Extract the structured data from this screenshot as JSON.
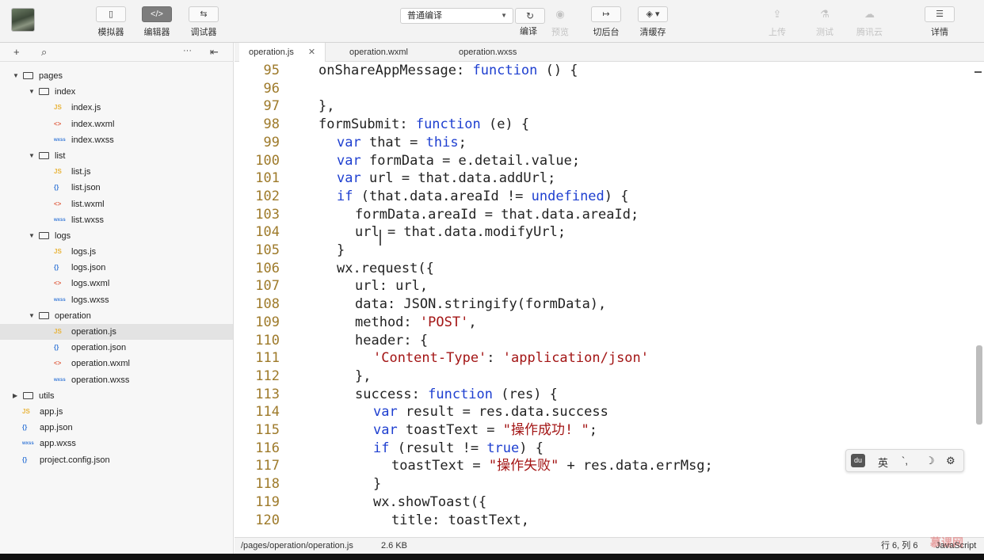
{
  "toolbar": {
    "simulator_label": "模拟器",
    "editor_label": "编辑器",
    "debugger_label": "调试器",
    "compile_mode": "普通编译",
    "compile_label": "编译",
    "preview_label": "预览",
    "background_label": "切后台",
    "clear_cache_label": "清缓存",
    "upload_label": "上传",
    "test_label": "测试",
    "tencent_cloud_label": "腾讯云",
    "details_label": "详情"
  },
  "tree": [
    {
      "kind": "folder",
      "name": "pages",
      "depth": 0,
      "open": true
    },
    {
      "kind": "folder",
      "name": "index",
      "depth": 1,
      "open": true
    },
    {
      "kind": "file",
      "type": "JS",
      "name": "index.js",
      "depth": 2
    },
    {
      "kind": "file",
      "type": "<>",
      "name": "index.wxml",
      "depth": 2
    },
    {
      "kind": "file",
      "type": "wxss",
      "name": "index.wxss",
      "depth": 2
    },
    {
      "kind": "folder",
      "name": "list",
      "depth": 1,
      "open": true
    },
    {
      "kind": "file",
      "type": "JS",
      "name": "list.js",
      "depth": 2
    },
    {
      "kind": "file",
      "type": "{}",
      "name": "list.json",
      "depth": 2
    },
    {
      "kind": "file",
      "type": "<>",
      "name": "list.wxml",
      "depth": 2
    },
    {
      "kind": "file",
      "type": "wxss",
      "name": "list.wxss",
      "depth": 2
    },
    {
      "kind": "folder",
      "name": "logs",
      "depth": 1,
      "open": true
    },
    {
      "kind": "file",
      "type": "JS",
      "name": "logs.js",
      "depth": 2
    },
    {
      "kind": "file",
      "type": "{}",
      "name": "logs.json",
      "depth": 2
    },
    {
      "kind": "file",
      "type": "<>",
      "name": "logs.wxml",
      "depth": 2
    },
    {
      "kind": "file",
      "type": "wxss",
      "name": "logs.wxss",
      "depth": 2
    },
    {
      "kind": "folder",
      "name": "operation",
      "depth": 1,
      "open": true
    },
    {
      "kind": "file",
      "type": "JS",
      "name": "operation.js",
      "depth": 2,
      "selected": true
    },
    {
      "kind": "file",
      "type": "{}",
      "name": "operation.json",
      "depth": 2
    },
    {
      "kind": "file",
      "type": "<>",
      "name": "operation.wxml",
      "depth": 2
    },
    {
      "kind": "file",
      "type": "wxss",
      "name": "operation.wxss",
      "depth": 2
    },
    {
      "kind": "folder",
      "name": "utils",
      "depth": 0,
      "open": false
    },
    {
      "kind": "file",
      "type": "JS",
      "name": "app.js",
      "depth": 0
    },
    {
      "kind": "file",
      "type": "{}",
      "name": "app.json",
      "depth": 0
    },
    {
      "kind": "file",
      "type": "wxss",
      "name": "app.wxss",
      "depth": 0
    },
    {
      "kind": "file",
      "type": "{}",
      "name": "project.config.json",
      "depth": 0
    }
  ],
  "tabs": [
    {
      "label": "operation.js",
      "active": true
    },
    {
      "label": "operation.wxml",
      "active": false
    },
    {
      "label": "operation.wxss",
      "active": false
    }
  ],
  "code_lines": [
    {
      "num": "95",
      "indent": 0,
      "parts": [
        [
          "n",
          "onShareAppMessage: "
        ],
        [
          "k",
          "function"
        ],
        [
          "n",
          " () {"
        ]
      ]
    },
    {
      "num": "96",
      "indent": 0,
      "parts": []
    },
    {
      "num": "97",
      "indent": 0,
      "parts": [
        [
          "n",
          "},"
        ]
      ]
    },
    {
      "num": "98",
      "indent": 0,
      "parts": [
        [
          "n",
          "formSubmit: "
        ],
        [
          "k",
          "function"
        ],
        [
          "n",
          " (e) {"
        ]
      ]
    },
    {
      "num": "99",
      "indent": 1,
      "parts": [
        [
          "k",
          "var"
        ],
        [
          "n",
          " that = "
        ],
        [
          "k",
          "this"
        ],
        [
          "n",
          ";"
        ]
      ]
    },
    {
      "num": "100",
      "indent": 1,
      "parts": [
        [
          "k",
          "var"
        ],
        [
          "n",
          " formData = e.detail.value;"
        ]
      ]
    },
    {
      "num": "101",
      "indent": 1,
      "parts": [
        [
          "k",
          "var"
        ],
        [
          "n",
          " url = that.data.addUrl;"
        ]
      ]
    },
    {
      "num": "102",
      "indent": 1,
      "parts": [
        [
          "k",
          "if"
        ],
        [
          "n",
          " (that.data.areaId != "
        ],
        [
          "k",
          "undefined"
        ],
        [
          "n",
          ") {"
        ]
      ]
    },
    {
      "num": "103",
      "indent": 2,
      "parts": [
        [
          "n",
          "formData.areaId = that.data.areaId;"
        ]
      ]
    },
    {
      "num": "104",
      "indent": 2,
      "parts": [
        [
          "n",
          "url = that.data.modifyUrl;"
        ]
      ]
    },
    {
      "num": "105",
      "indent": 1,
      "parts": [
        [
          "n",
          "}"
        ]
      ]
    },
    {
      "num": "106",
      "indent": 1,
      "parts": [
        [
          "n",
          "wx.request({"
        ]
      ]
    },
    {
      "num": "107",
      "indent": 2,
      "parts": [
        [
          "n",
          "url: url,"
        ]
      ]
    },
    {
      "num": "108",
      "indent": 2,
      "parts": [
        [
          "n",
          "data: JSON.stringify(formData),"
        ]
      ]
    },
    {
      "num": "109",
      "indent": 2,
      "parts": [
        [
          "n",
          "method: "
        ],
        [
          "s",
          "'POST'"
        ],
        [
          "n",
          ","
        ]
      ]
    },
    {
      "num": "110",
      "indent": 2,
      "parts": [
        [
          "n",
          "header: {"
        ]
      ]
    },
    {
      "num": "111",
      "indent": 3,
      "parts": [
        [
          "s",
          "'Content-Type'"
        ],
        [
          "n",
          ": "
        ],
        [
          "s",
          "'application/json'"
        ]
      ]
    },
    {
      "num": "112",
      "indent": 2,
      "parts": [
        [
          "n",
          "},"
        ]
      ]
    },
    {
      "num": "113",
      "indent": 2,
      "parts": [
        [
          "n",
          "success: "
        ],
        [
          "k",
          "function"
        ],
        [
          "n",
          " (res) {"
        ]
      ]
    },
    {
      "num": "114",
      "indent": 3,
      "parts": [
        [
          "k",
          "var"
        ],
        [
          "n",
          " result = res.data.success"
        ]
      ]
    },
    {
      "num": "115",
      "indent": 3,
      "parts": [
        [
          "k",
          "var"
        ],
        [
          "n",
          " toastText = "
        ],
        [
          "s",
          "\"操作成功! \""
        ],
        [
          "n",
          ";"
        ]
      ]
    },
    {
      "num": "116",
      "indent": 3,
      "parts": [
        [
          "k",
          "if"
        ],
        [
          "n",
          " (result != "
        ],
        [
          "k",
          "true"
        ],
        [
          "n",
          ") {"
        ]
      ]
    },
    {
      "num": "117",
      "indent": 4,
      "parts": [
        [
          "n",
          "toastText = "
        ],
        [
          "s",
          "\"操作失败\""
        ],
        [
          "n",
          " + res.data.errMsg;"
        ]
      ]
    },
    {
      "num": "118",
      "indent": 3,
      "parts": [
        [
          "n",
          "}"
        ]
      ]
    },
    {
      "num": "119",
      "indent": 3,
      "parts": [
        [
          "n",
          "wx.showToast({"
        ]
      ]
    },
    {
      "num": "120",
      "indent": 4,
      "parts": [
        [
          "n",
          "title: toastText,"
        ]
      ]
    }
  ],
  "status": {
    "path": "/pages/operation/operation.js",
    "size": "2.6 KB",
    "position": "行 6, 列 6",
    "language": "JavaScript"
  },
  "ime": {
    "logo": "du",
    "lang": "英",
    "punct": "`,",
    "moon": "☽",
    "gear": "⚙"
  },
  "watermark": "慕课网",
  "icons": {
    "add": "+",
    "search": "⌕",
    "more": "···",
    "collapse": "⇤",
    "close_tab": "✕"
  }
}
